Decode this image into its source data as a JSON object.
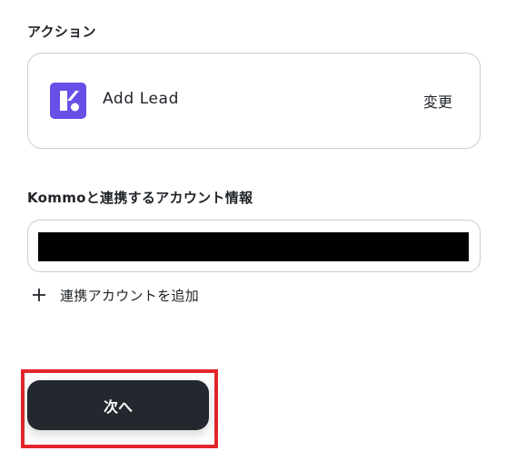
{
  "action": {
    "section_label": "アクション",
    "app_icon": "kommo-logo",
    "name": "Add Lead",
    "change_label": "変更"
  },
  "account": {
    "section_label": "Kommoと連携するアカウント情報",
    "value_redacted": true,
    "add_label": "連携アカウントを追加"
  },
  "footer": {
    "next_label": "次へ"
  },
  "colors": {
    "brand_purple": "#6a4ee8",
    "button_dark": "#23272e",
    "highlight_red": "#e3262b",
    "border": "#c9ccd1"
  }
}
